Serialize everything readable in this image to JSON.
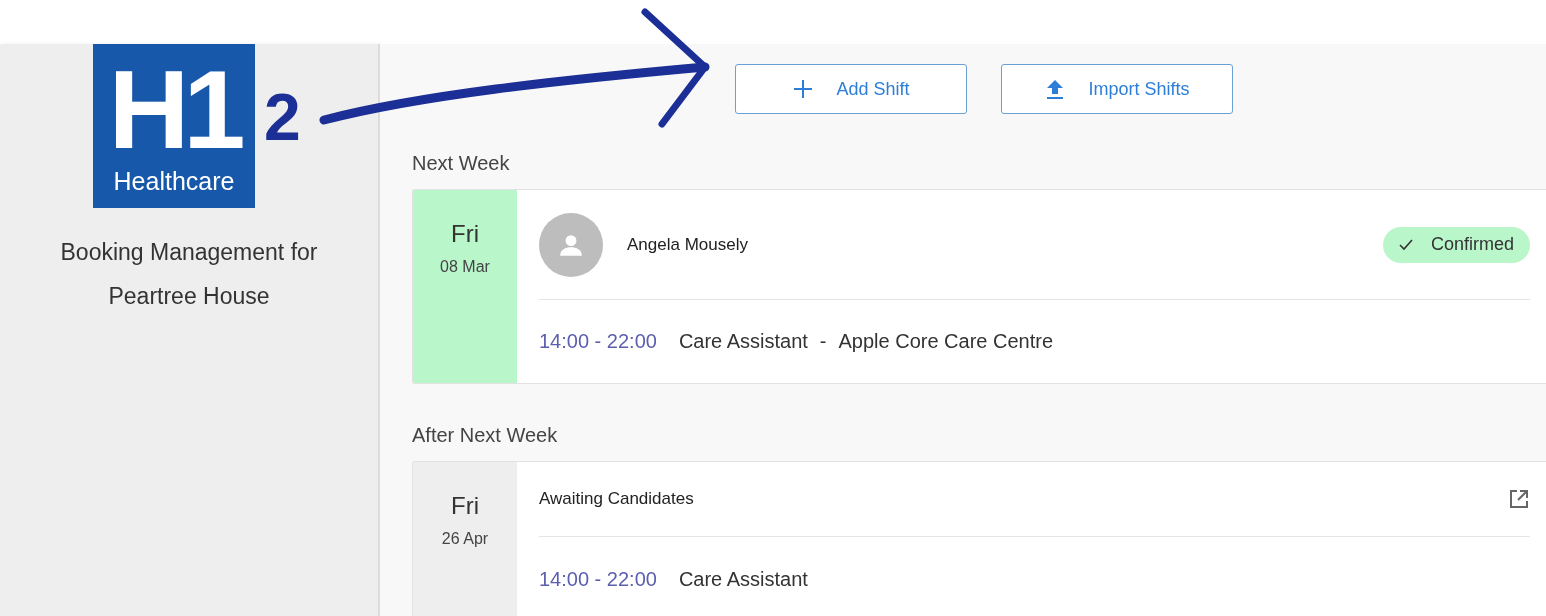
{
  "logo": {
    "mark": "H1",
    "subtitle": "Healthcare"
  },
  "annotation": {
    "step": "2"
  },
  "sidebar": {
    "title": "Booking Management for Peartree House"
  },
  "toolbar": {
    "buttons": [
      {
        "label": "Add Shift",
        "kind": "add"
      },
      {
        "label": "Import Shifts",
        "kind": "import"
      }
    ]
  },
  "groups": [
    {
      "heading": "Next Week",
      "shifts": [
        {
          "kind": "assigned",
          "day": "Fri",
          "date": "08 Mar",
          "name": "Angela Mousely",
          "status": "Confirmed",
          "time": "14:00 - 22:00",
          "role": "Care Assistant",
          "separator": "-",
          "location": "Apple Core Care Centre"
        }
      ]
    },
    {
      "heading": "After Next Week",
      "shifts": [
        {
          "kind": "open",
          "day": "Fri",
          "date": "26 Apr",
          "title": "Awaiting Candidates",
          "time": "14:00 - 22:00",
          "role": "Care Assistant"
        }
      ]
    }
  ]
}
